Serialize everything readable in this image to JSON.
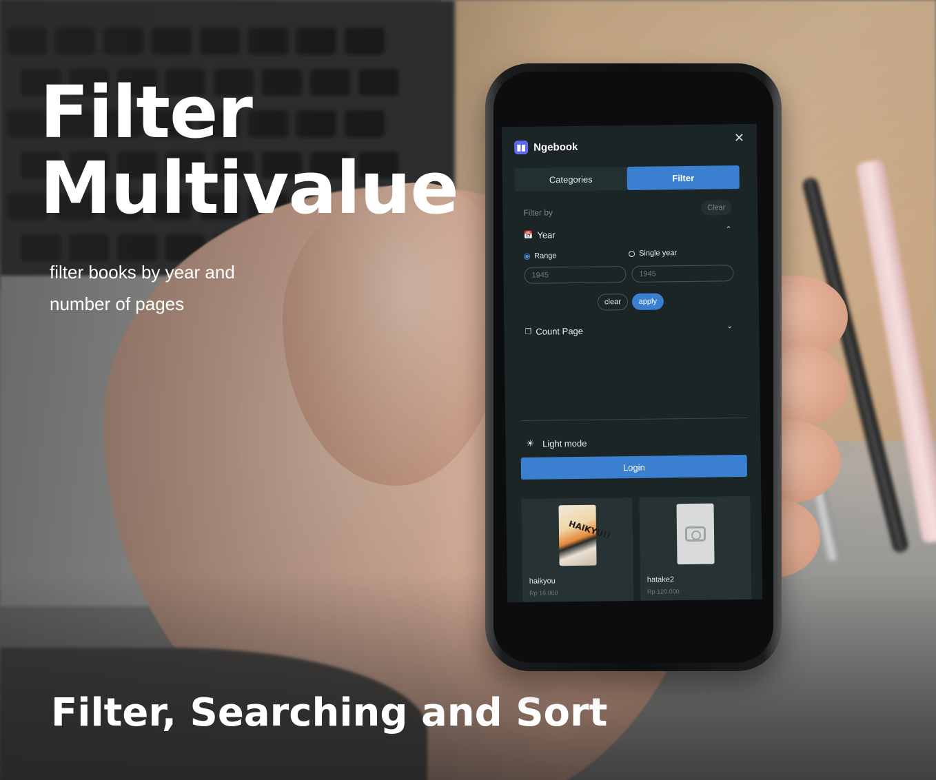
{
  "hero": {
    "headline_line1": "Filter",
    "headline_line2": "Multivalue",
    "subtitle_line1": "filter books by year and",
    "subtitle_line2": "number of pages",
    "footer_title": "Filter, Searching and Sort"
  },
  "app": {
    "name": "Ngebook",
    "logo_icon": "book-icon",
    "close_icon": "close-icon",
    "tabs": [
      {
        "label": "Categories",
        "active": false
      },
      {
        "label": "Filter",
        "active": true
      }
    ],
    "filter_by_label": "Filter by",
    "clear_label": "Clear",
    "year_section": {
      "label": "Year",
      "icon": "calendar-icon",
      "expanded": true,
      "options": [
        {
          "label": "Range",
          "selected": true
        },
        {
          "label": "Single year",
          "selected": false
        }
      ],
      "input_from_placeholder": "1945",
      "input_to_placeholder": "1945",
      "clear_button": "clear",
      "apply_button": "apply"
    },
    "count_page_section": {
      "label": "Count Page",
      "icon": "pages-icon",
      "expanded": false
    },
    "light_mode_label": "Light mode",
    "light_mode_icon": "sun-icon",
    "login_label": "Login",
    "books": [
      {
        "title": "haikyou",
        "price": "Rp 16.000",
        "cover": "manga-cover",
        "cover_text": "HAIKYU!!"
      },
      {
        "title": "hatake2",
        "price": "Rp 120.000",
        "cover": "image-placeholder"
      }
    ],
    "colors": {
      "primary": "#3a7fd0",
      "background": "#1c2526",
      "logo": "#5b6cf0"
    }
  }
}
